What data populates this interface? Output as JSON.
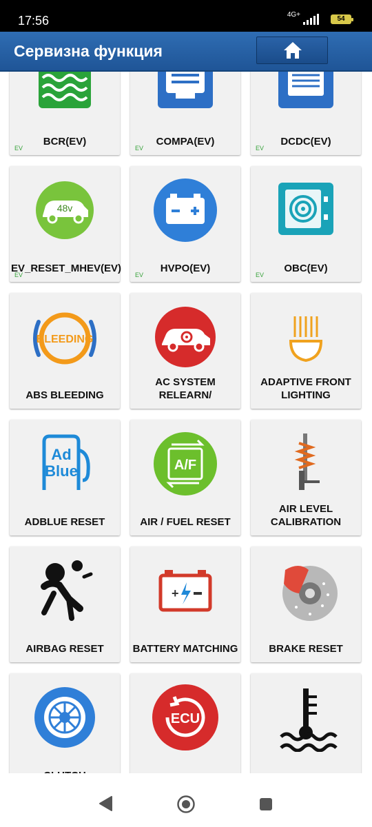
{
  "status": {
    "time": "17:56",
    "network": "4G+",
    "battery": "54"
  },
  "header": {
    "title": "Сервизна функция"
  },
  "ev_tag": "EV",
  "tiles": [
    {
      "label": "BCR(EV)",
      "ev": true,
      "icon": "coolant-tank-icon"
    },
    {
      "label": "COMPA(EV)",
      "ev": true,
      "icon": "compressor-icon"
    },
    {
      "label": "DCDC(EV)",
      "ev": true,
      "icon": "dcdc-converter-icon"
    },
    {
      "label": "EV_RESET_MHEV(EV)",
      "ev": true,
      "icon": "48v-car-icon"
    },
    {
      "label": "HVPO(EV)",
      "ev": true,
      "icon": "battery-icon"
    },
    {
      "label": "OBC(EV)",
      "ev": true,
      "icon": "charger-icon"
    },
    {
      "label": "ABS BLEEDING",
      "ev": false,
      "icon": "abs-bleeding-icon"
    },
    {
      "label": "AC SYSTEM RELEARN/",
      "ev": false,
      "icon": "ac-car-icon"
    },
    {
      "label": "ADAPTIVE FRONT LIGHTING",
      "ev": false,
      "icon": "headlight-icon"
    },
    {
      "label": "ADBLUE RESET",
      "ev": false,
      "icon": "adblue-icon"
    },
    {
      "label": "AIR / FUEL RESET",
      "ev": false,
      "icon": "air-fuel-icon"
    },
    {
      "label": "AIR LEVEL CALIBRATION",
      "ev": false,
      "icon": "suspension-icon"
    },
    {
      "label": "AIRBAG RESET",
      "ev": false,
      "icon": "airbag-icon"
    },
    {
      "label": "BATTERY MATCHING",
      "ev": false,
      "icon": "battery-matching-icon"
    },
    {
      "label": "BRAKE RESET",
      "ev": false,
      "icon": "brake-disc-icon"
    },
    {
      "label": "CLUTCH",
      "ev": false,
      "icon": "clutch-icon"
    },
    {
      "label": "",
      "ev": false,
      "icon": "ecu-reset-icon"
    },
    {
      "label": "",
      "ev": false,
      "icon": "coolant-temp-icon"
    }
  ],
  "nav": {
    "back": "back-icon",
    "home": "home-circle-icon",
    "recents": "recents-icon"
  }
}
